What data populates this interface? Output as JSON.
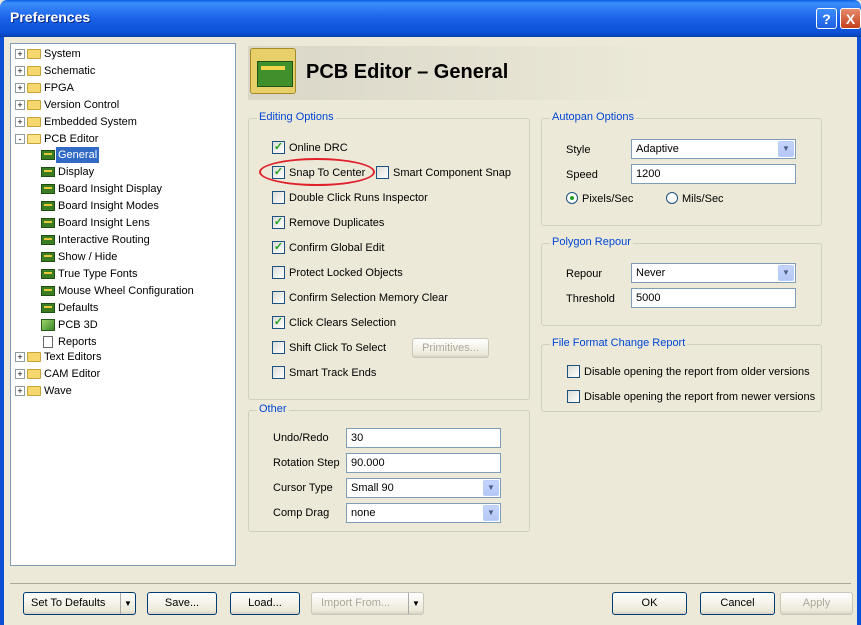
{
  "window": {
    "title": "Preferences",
    "help_button": "?",
    "close_button": "X"
  },
  "tree": {
    "items": [
      {
        "label": "System",
        "expander": "+"
      },
      {
        "label": "Schematic",
        "expander": "+"
      },
      {
        "label": "FPGA",
        "expander": "+"
      },
      {
        "label": "Version Control",
        "expander": "+"
      },
      {
        "label": "Embedded System",
        "expander": "+"
      },
      {
        "label": "PCB Editor",
        "expander": "-"
      },
      {
        "label": "General",
        "selected": true
      },
      {
        "label": "Display"
      },
      {
        "label": "Board Insight Display"
      },
      {
        "label": "Board Insight Modes"
      },
      {
        "label": "Board Insight Lens"
      },
      {
        "label": "Interactive Routing"
      },
      {
        "label": "Show / Hide"
      },
      {
        "label": "True Type Fonts"
      },
      {
        "label": "Mouse Wheel Configuration"
      },
      {
        "label": "Defaults"
      },
      {
        "label": "PCB 3D"
      },
      {
        "label": "Reports"
      },
      {
        "label": "Text Editors",
        "expander": "+"
      },
      {
        "label": "CAM Editor",
        "expander": "+"
      },
      {
        "label": "Wave",
        "expander": "+"
      }
    ]
  },
  "header": {
    "title": "PCB Editor – General"
  },
  "editing_options": {
    "title": "Editing Options",
    "online_drc": {
      "label": "Online DRC",
      "checked": true
    },
    "snap_to_center": {
      "label": "Snap To Center",
      "checked": true
    },
    "smart_component_snap": {
      "label": "Smart Component Snap",
      "checked": false
    },
    "double_click_runs_inspector": {
      "label": "Double Click Runs Inspector",
      "checked": false
    },
    "remove_duplicates": {
      "label": "Remove Duplicates",
      "checked": true
    },
    "confirm_global_edit": {
      "label": "Confirm Global Edit",
      "checked": true
    },
    "protect_locked_objects": {
      "label": "Protect Locked Objects",
      "checked": false
    },
    "confirm_selection_memory_clear": {
      "label": "Confirm Selection Memory Clear",
      "checked": false
    },
    "click_clears_selection": {
      "label": "Click Clears Selection",
      "checked": true
    },
    "shift_click_to_select": {
      "label": "Shift Click To Select",
      "checked": false
    },
    "primitives_button": "Primitives...",
    "smart_track_ends": {
      "label": "Smart Track Ends",
      "checked": false
    }
  },
  "other": {
    "title": "Other",
    "undo_redo": {
      "label": "Undo/Redo",
      "value": "30"
    },
    "rotation_step": {
      "label": "Rotation Step",
      "value": "90.000"
    },
    "cursor_type": {
      "label": "Cursor Type",
      "value": "Small 90"
    },
    "comp_drag": {
      "label": "Comp Drag",
      "value": "none"
    }
  },
  "autopan": {
    "title": "Autopan Options",
    "style": {
      "label": "Style",
      "value": "Adaptive"
    },
    "speed": {
      "label": "Speed",
      "value": "1200"
    },
    "pixels_sec": {
      "label": "Pixels/Sec",
      "selected": true
    },
    "mils_sec": {
      "label": "Mils/Sec",
      "selected": false
    }
  },
  "polygon_repour": {
    "title": "Polygon Repour",
    "repour": {
      "label": "Repour",
      "value": "Never"
    },
    "threshold": {
      "label": "Threshold",
      "value": "5000"
    }
  },
  "file_format": {
    "title": "File Format Change Report",
    "disable_older": {
      "label": "Disable opening the report from older versions",
      "checked": false
    },
    "disable_newer": {
      "label": "Disable opening the report from newer versions",
      "checked": false
    }
  },
  "footer": {
    "set_to_defaults": "Set To Defaults",
    "save": "Save...",
    "load": "Load...",
    "import_from": "Import From...",
    "ok": "OK",
    "cancel": "Cancel",
    "apply": "Apply"
  },
  "check_glyph": "✓",
  "arrow_glyph": "▼"
}
